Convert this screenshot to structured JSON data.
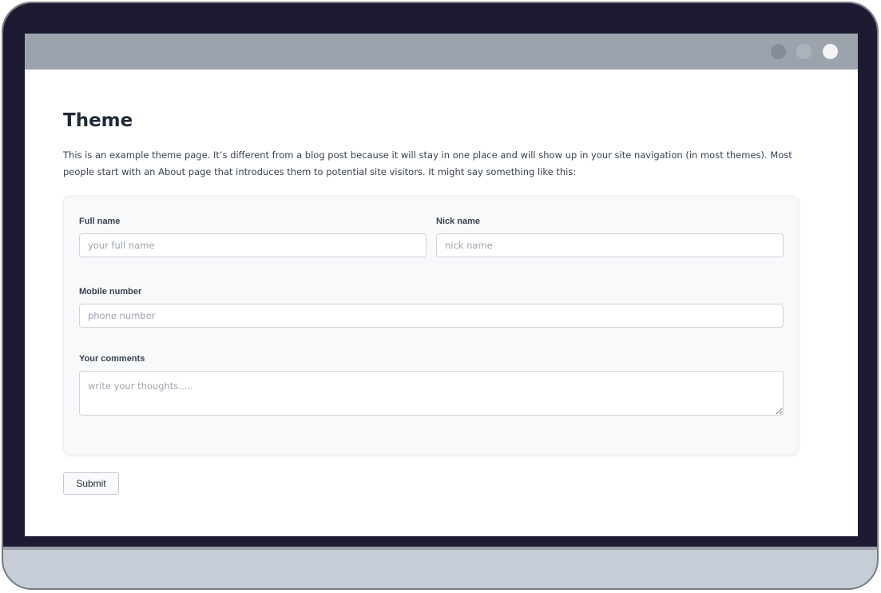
{
  "page": {
    "title": "Theme",
    "intro": "This is an example theme page. It’s different from a blog post because it will stay in one place and will show up in your site navigation (in most themes). Most people start with an About page that introduces them to potential site visitors. It might say something like this:"
  },
  "form": {
    "full_name": {
      "label": "Full name",
      "placeholder": "your full name",
      "value": ""
    },
    "nick_name": {
      "label": "Nick name",
      "placeholder": "nick name",
      "value": ""
    },
    "mobile": {
      "label": "Mobile number",
      "placeholder": "phone number",
      "value": ""
    },
    "comments": {
      "label": "Your comments",
      "placeholder": "write your thoughts.....",
      "value": ""
    },
    "submit_label": "Submit"
  },
  "colors": {
    "bezel": "#1c1b31",
    "titlebar": "#9ca3ad",
    "card_background": "#f8f9fa",
    "device_base": "#c7cdd6"
  }
}
